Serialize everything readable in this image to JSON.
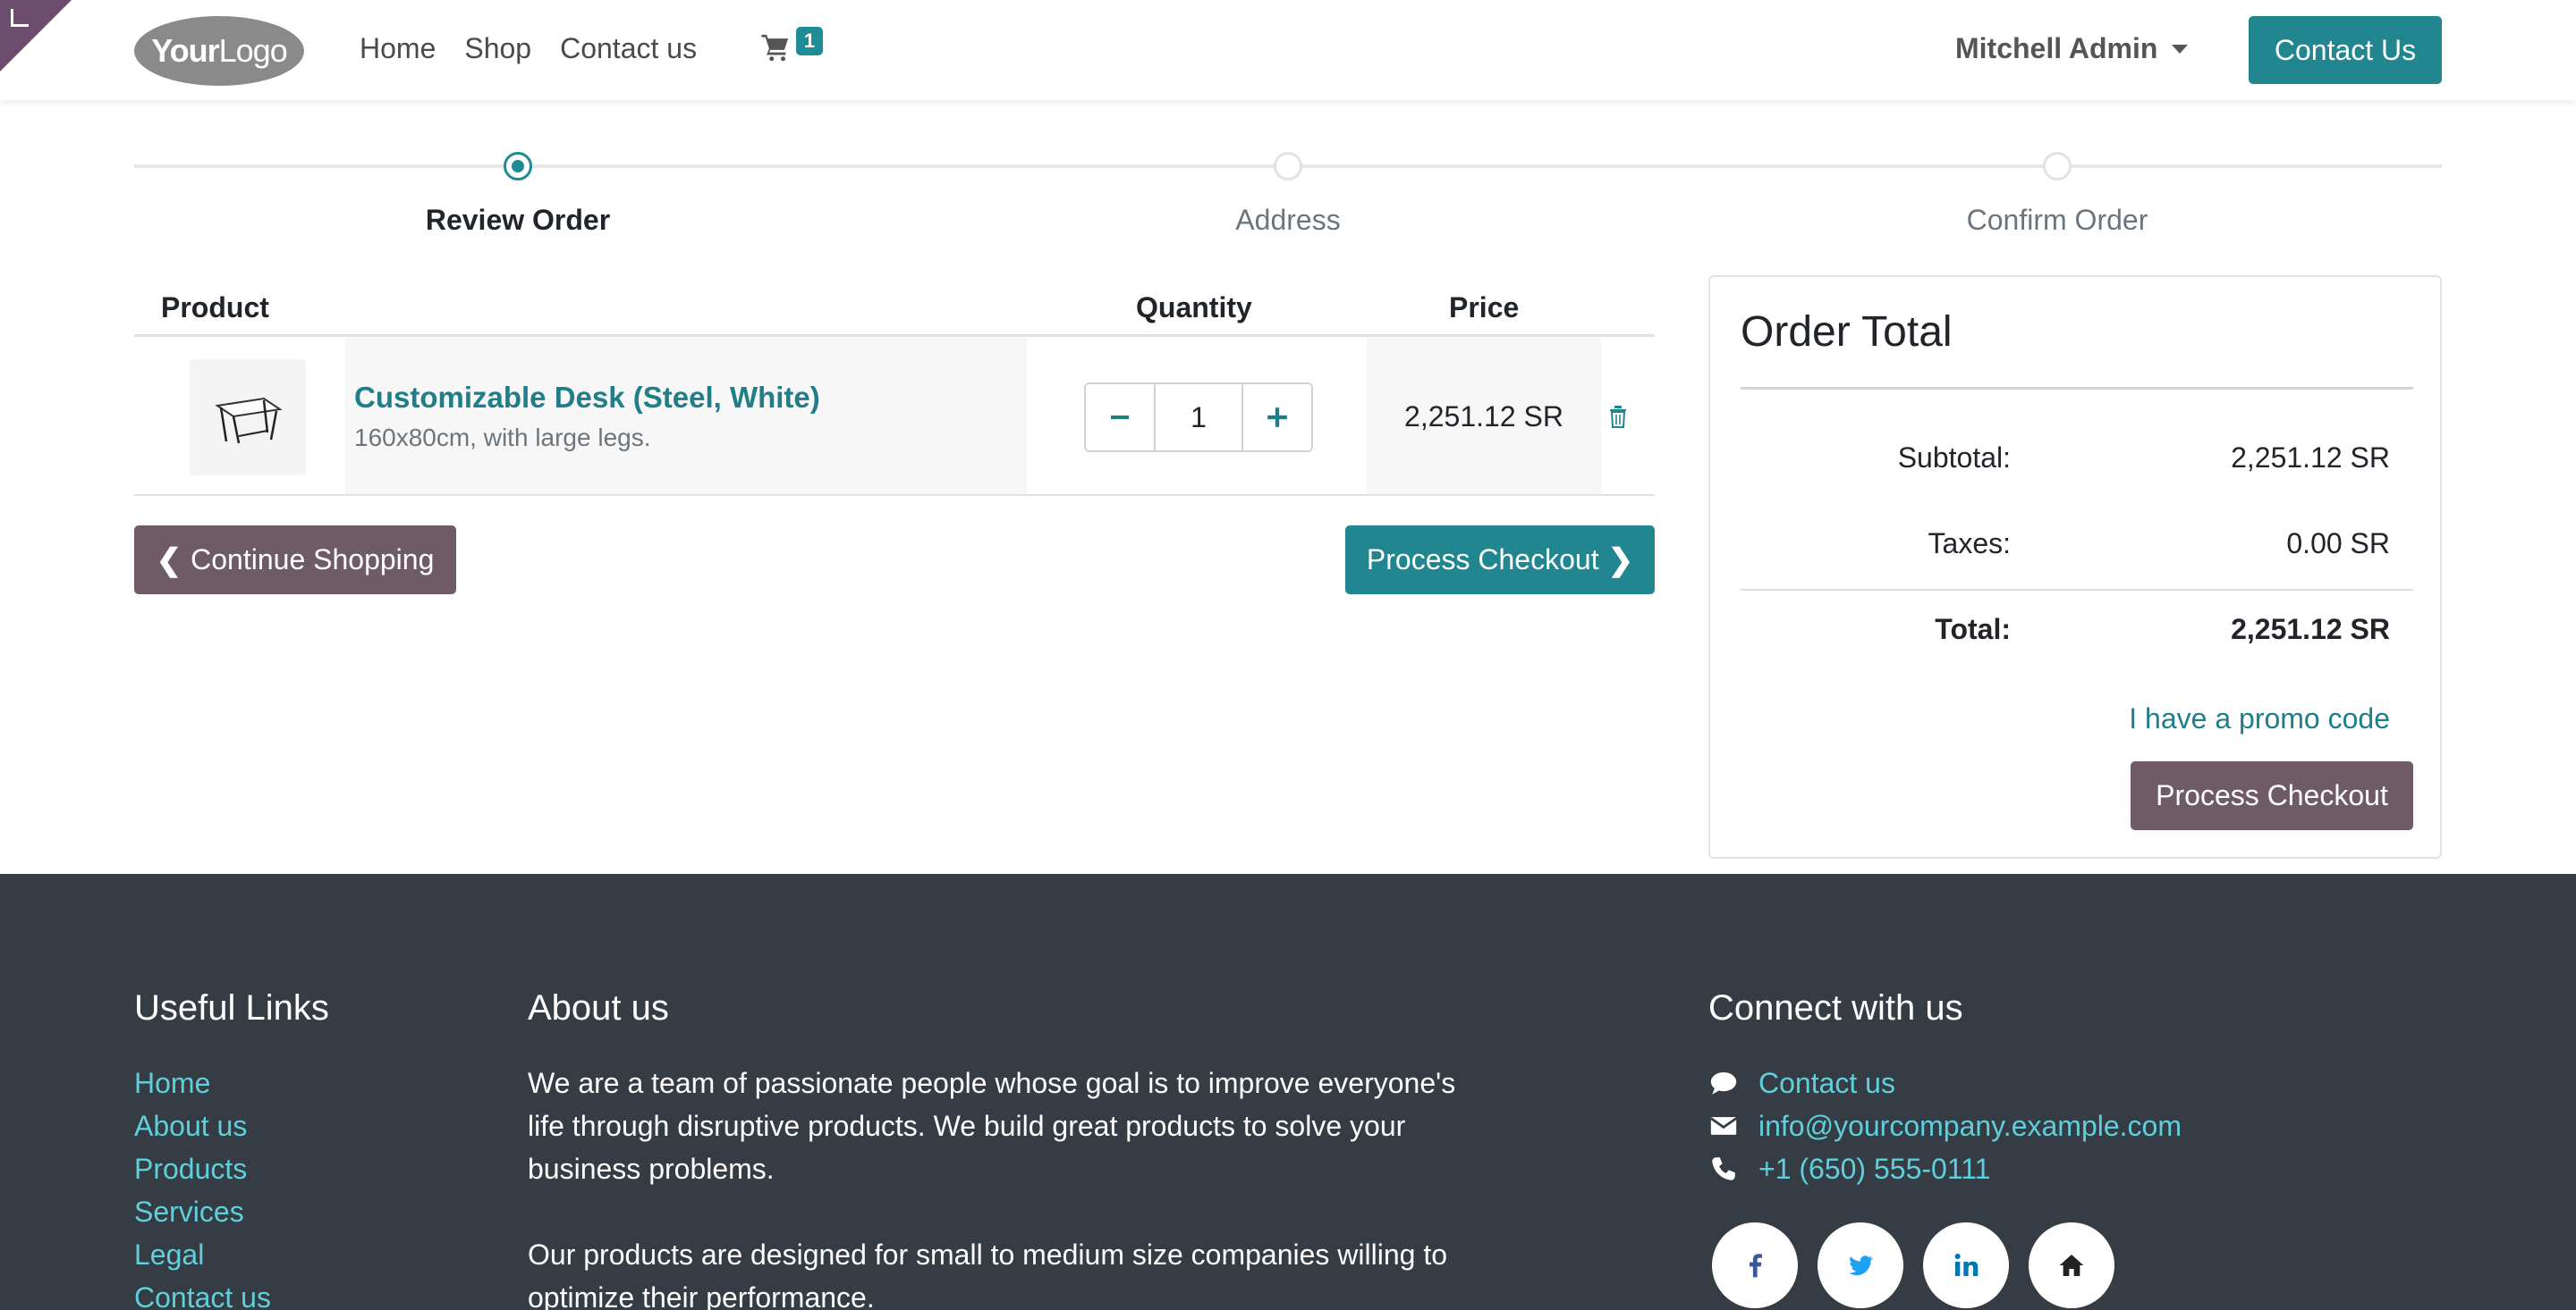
{
  "header": {
    "logo_text_bold": "Your",
    "logo_text_light": "Logo",
    "nav": [
      "Home",
      "Shop",
      "Contact us"
    ],
    "cart_count": "1",
    "user_name": "Mitchell Admin",
    "cta_label": "Contact Us"
  },
  "checkout_steps": [
    {
      "label": "Review Order",
      "active": true
    },
    {
      "label": "Address",
      "active": false
    },
    {
      "label": "Confirm Order",
      "active": false
    }
  ],
  "cart_table": {
    "headers": {
      "product": "Product",
      "quantity": "Quantity",
      "price": "Price"
    },
    "items": [
      {
        "name": "Customizable Desk (Steel, White)",
        "description": "160x80cm, with large legs.",
        "quantity": "1",
        "price": "2,251.12 SR"
      }
    ]
  },
  "actions": {
    "continue_label": "Continue Shopping",
    "process_label": "Process Checkout"
  },
  "order_total": {
    "title": "Order Total",
    "subtotal_label": "Subtotal:",
    "subtotal_value": "2,251.12 SR",
    "taxes_label": "Taxes:",
    "taxes_value": "0.00 SR",
    "total_label": "Total:",
    "total_value": "2,251.12 SR",
    "promo_label": "I have a promo code",
    "process_label": "Process Checkout"
  },
  "footer": {
    "links_title": "Useful Links",
    "links": [
      "Home",
      "About us",
      "Products",
      "Services",
      "Legal",
      "Contact us"
    ],
    "about_title": "About us",
    "about_p1": "We are a team of passionate people whose goal is to improve everyone's life through disruptive products. We build great products to solve your business problems.",
    "about_p2": "Our products are designed for small to medium size companies willing to optimize their performance.",
    "connect_title": "Connect with us",
    "contact_link": "Contact us",
    "email": "info@yourcompany.example.com",
    "phone": "+1 (650) 555-0111",
    "socials": [
      "facebook-icon",
      "twitter-icon",
      "linkedin-icon",
      "home-icon"
    ]
  },
  "colors": {
    "accent": "#21868f",
    "accent_text": "#1f7e88",
    "secondary_btn": "#6f5b65",
    "footer_bg": "#363c44",
    "footer_link": "#5fcfdb"
  }
}
